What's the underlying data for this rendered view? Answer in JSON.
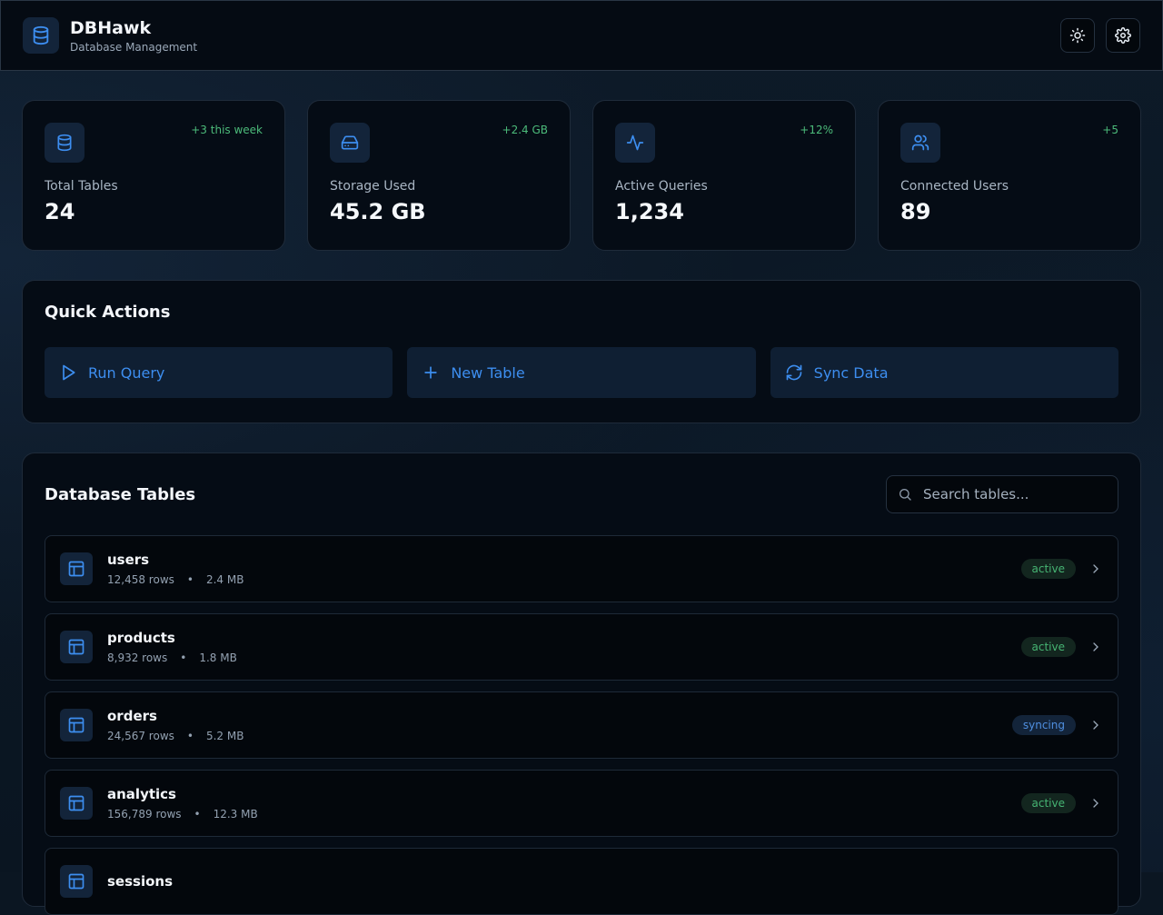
{
  "app": {
    "title": "DBHawk",
    "subtitle": "Database Management",
    "logo_icon": "database-icon",
    "theme_icon": "sun-icon",
    "settings_icon": "gear-icon"
  },
  "stats": [
    {
      "icon": "database-icon",
      "change": "+3 this week",
      "label": "Total Tables",
      "value": "24"
    },
    {
      "icon": "hard-drive-icon",
      "change": "+2.4 GB",
      "label": "Storage Used",
      "value": "45.2 GB"
    },
    {
      "icon": "activity-icon",
      "change": "+12%",
      "label": "Active Queries",
      "value": "1,234"
    },
    {
      "icon": "users-icon",
      "change": "+5",
      "label": "Connected Users",
      "value": "89"
    }
  ],
  "quick_actions": {
    "title": "Quick Actions",
    "buttons": [
      {
        "icon": "play-icon",
        "label": "Run Query"
      },
      {
        "icon": "plus-icon",
        "label": "New Table"
      },
      {
        "icon": "refresh-icon",
        "label": "Sync Data"
      }
    ]
  },
  "tables_panel": {
    "title": "Database Tables",
    "search_placeholder": "Search tables...",
    "rows": [
      {
        "name": "users",
        "rows": "12,458 rows",
        "dot": "•",
        "size": "2.4 MB",
        "status": "active"
      },
      {
        "name": "products",
        "rows": "8,932 rows",
        "dot": "•",
        "size": "1.8 MB",
        "status": "active"
      },
      {
        "name": "orders",
        "rows": "24,567 rows",
        "dot": "•",
        "size": "5.2 MB",
        "status": "syncing"
      },
      {
        "name": "analytics",
        "rows": "156,789 rows",
        "dot": "•",
        "size": "12.3 MB",
        "status": "active"
      },
      {
        "name": "sessions",
        "rows": "",
        "dot": "",
        "size": "",
        "status": ""
      }
    ]
  },
  "colors": {
    "accent": "#3d8ef0",
    "positive": "#4cbb7a",
    "background": "#0b1622",
    "card": "#050c15"
  }
}
